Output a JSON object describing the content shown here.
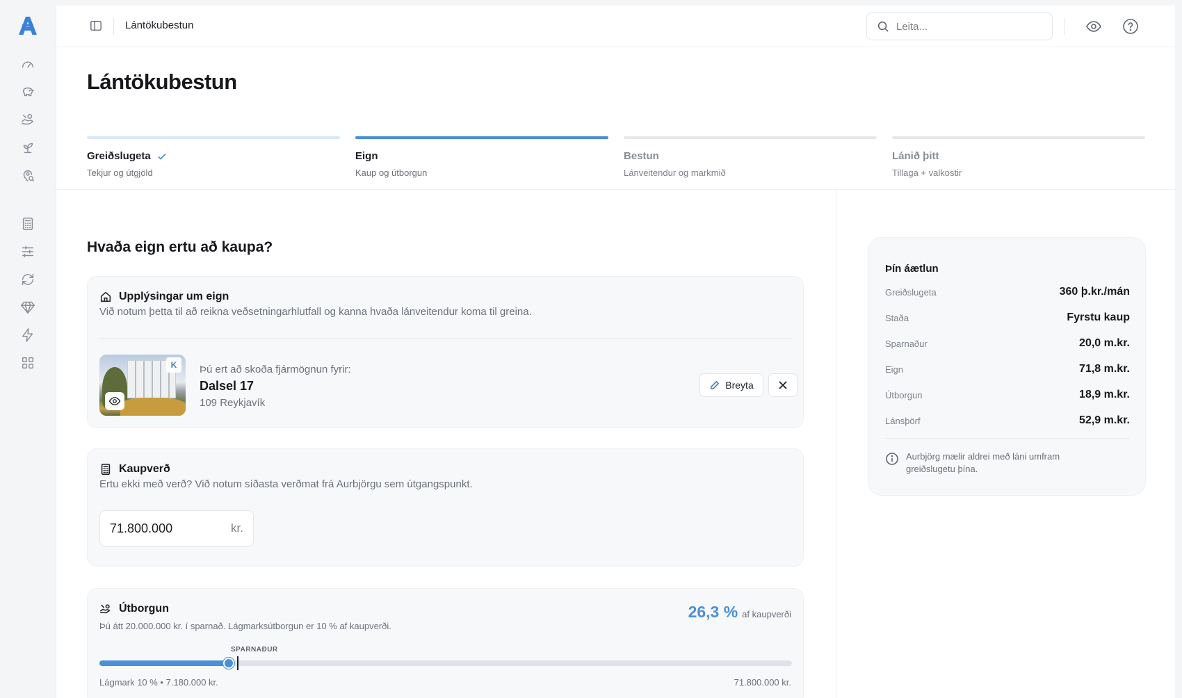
{
  "app": {
    "logo": "A"
  },
  "sidebar": {
    "group1": [
      {
        "icon": "gauge-icon"
      },
      {
        "icon": "piggy-bank-icon"
      },
      {
        "icon": "hand-coins-icon"
      },
      {
        "icon": "sprout-icon"
      },
      {
        "icon": "map-pin-search-icon"
      }
    ],
    "group2": [
      {
        "icon": "calculator-icon"
      },
      {
        "icon": "sliders-icon"
      },
      {
        "icon": "refresh-icon"
      },
      {
        "icon": "diamond-icon"
      },
      {
        "icon": "bolt-icon"
      },
      {
        "icon": "grid-icon"
      }
    ]
  },
  "topbar": {
    "title": "Lántökubestun",
    "search_placeholder": "Leita..."
  },
  "page": {
    "title": "Lántökubestun",
    "question": "Hvaða eign ertu að kaupa?"
  },
  "steps": [
    {
      "label": "Greiðslugeta",
      "sub": "Tekjur og útgjöld",
      "state": "done"
    },
    {
      "label": "Eign",
      "sub": "Kaup og útborgun",
      "state": "active"
    },
    {
      "label": "Bestun",
      "sub": "Lánveitendur og markmið",
      "state": "upcoming"
    },
    {
      "label": "Lánið þitt",
      "sub": "Tillaga + valkostir",
      "state": "upcoming"
    }
  ],
  "property_card": {
    "title": "Upplýsingar um eign",
    "desc": "Við notum þetta til að reikna veðsetningarhlutfall og kanna hvaða lánveitendur koma til greina.",
    "lead": "Þú ert að skoða fjármögnun fyrir:",
    "name": "Dalsel 17",
    "city": "109 Reykjavík",
    "edit_label": "Breyta"
  },
  "price_card": {
    "title": "Kaupverð",
    "desc": "Ertu ekki með verð? Við notum síðasta verðmat frá Aurbjörgu sem útgangspunkt.",
    "value": "71.800.000",
    "unit": "kr."
  },
  "down_card": {
    "title": "Útborgun",
    "desc": "Þú átt 20.000.000 kr. í sparnað. Lágmarksútborgun er 10 % af kaupverði.",
    "pct": "26,3 %",
    "pct_sub": "af kaupverði",
    "savings_tag": "SPARNAÐUR",
    "slider_fraction": 0.187,
    "savings_fraction": 0.199,
    "min_label": "Lágmark 10 % • 7.180.000 kr.",
    "max_label": "71.800.000 kr."
  },
  "plan": {
    "title": "Þín áætlun",
    "rows": [
      {
        "k": "Greiðslugeta",
        "v": "360 þ.kr./mán"
      },
      {
        "k": "Staða",
        "v": "Fyrstu kaup"
      },
      {
        "k": "Sparnaður",
        "v": "20,0 m.kr."
      },
      {
        "k": "Eign",
        "v": "71,8 m.kr."
      },
      {
        "k": "Útborgun",
        "v": "18,9 m.kr."
      },
      {
        "k": "Lánsþörf",
        "v": "52,9 m.kr."
      }
    ],
    "note": "Aurbjörg mælir aldrei með láni umfram greiðslugetu þína."
  },
  "colors": {
    "accent": "#4a90d9"
  }
}
